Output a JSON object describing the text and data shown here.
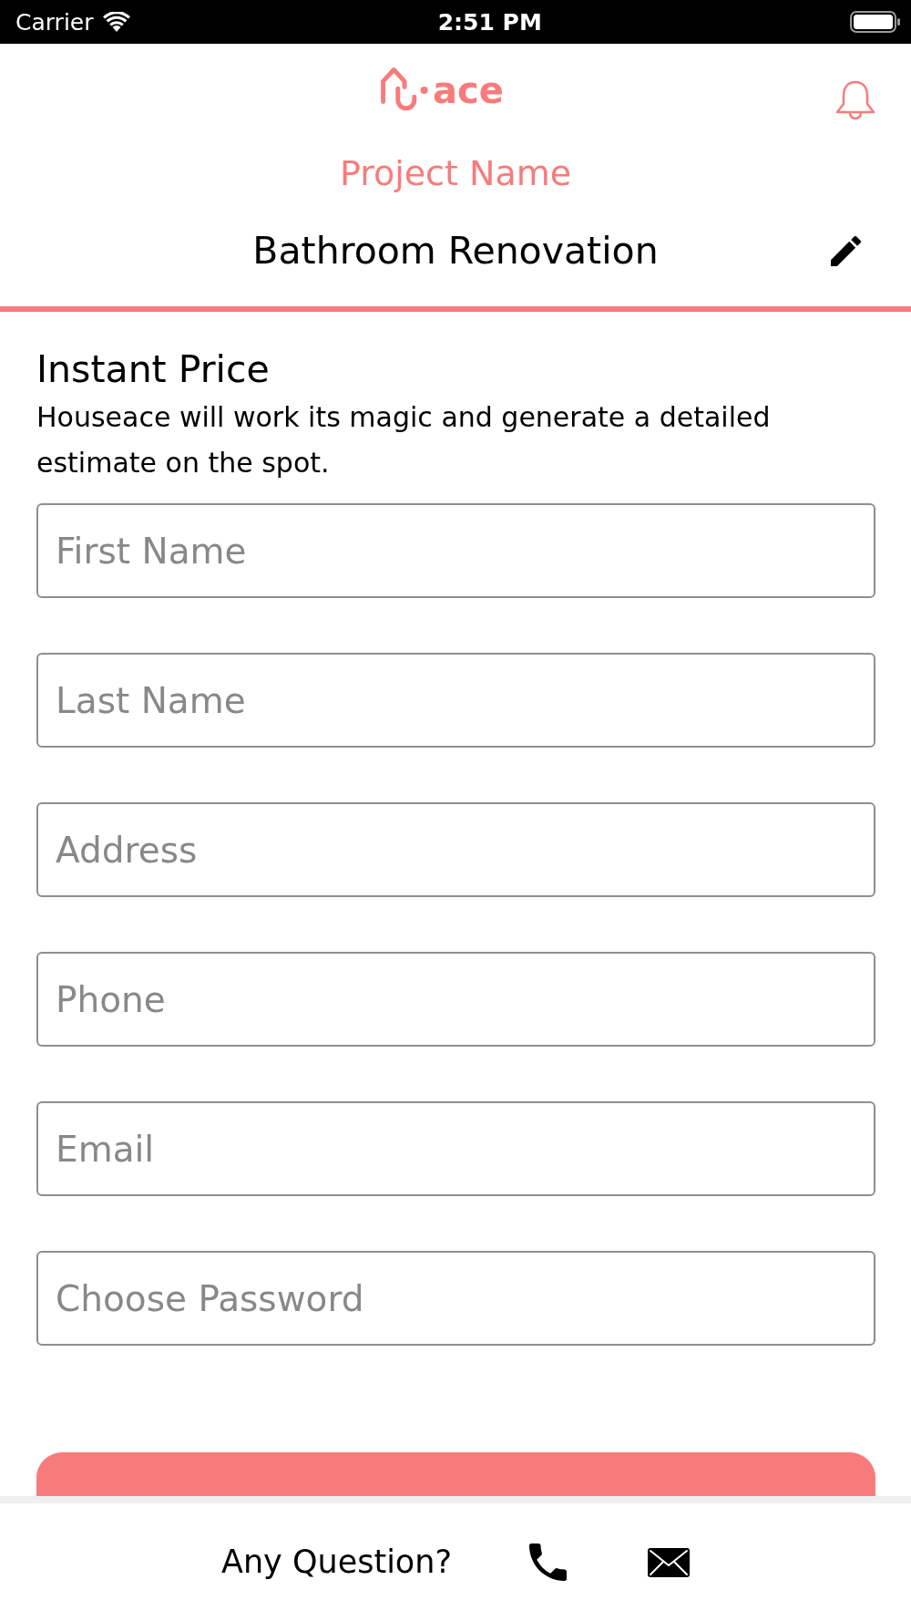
{
  "status_bar": {
    "carrier": "Carrier",
    "time": "2:51 PM"
  },
  "header": {
    "logo_text": "ace",
    "project_label": "Project Name",
    "project_name": "Bathroom Renovation"
  },
  "section": {
    "title": "Instant Price",
    "description": "Houseace will work its magic and generate a detailed estimate on the spot."
  },
  "form": {
    "fields": [
      {
        "placeholder": "First Name"
      },
      {
        "placeholder": "Last Name"
      },
      {
        "placeholder": "Address"
      },
      {
        "placeholder": "Phone"
      },
      {
        "placeholder": "Email"
      },
      {
        "placeholder": "Choose Password"
      }
    ]
  },
  "footer": {
    "question": "Any Question?"
  }
}
